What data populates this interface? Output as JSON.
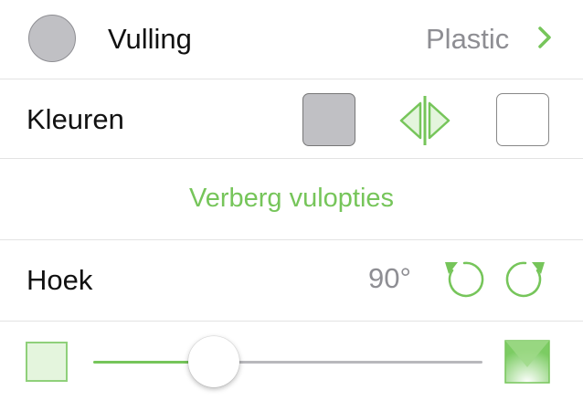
{
  "fill": {
    "label": "Vulling",
    "value": "Plastic",
    "icon": "chevron-right-icon"
  },
  "colors": {
    "label": "Kleuren",
    "swatch_a": "#c0c0c4",
    "swatch_b": "#ffffff",
    "swap_icon": "swap-colors-icon"
  },
  "hide_link": "Verberg vulopties",
  "angle": {
    "label": "Hoek",
    "value": "90°",
    "rotate_left_icon": "rotate-ccw-icon",
    "rotate_right_icon": "rotate-cw-icon"
  },
  "slider": {
    "value_fraction": 0.31
  },
  "accent_color": "#76c55a"
}
